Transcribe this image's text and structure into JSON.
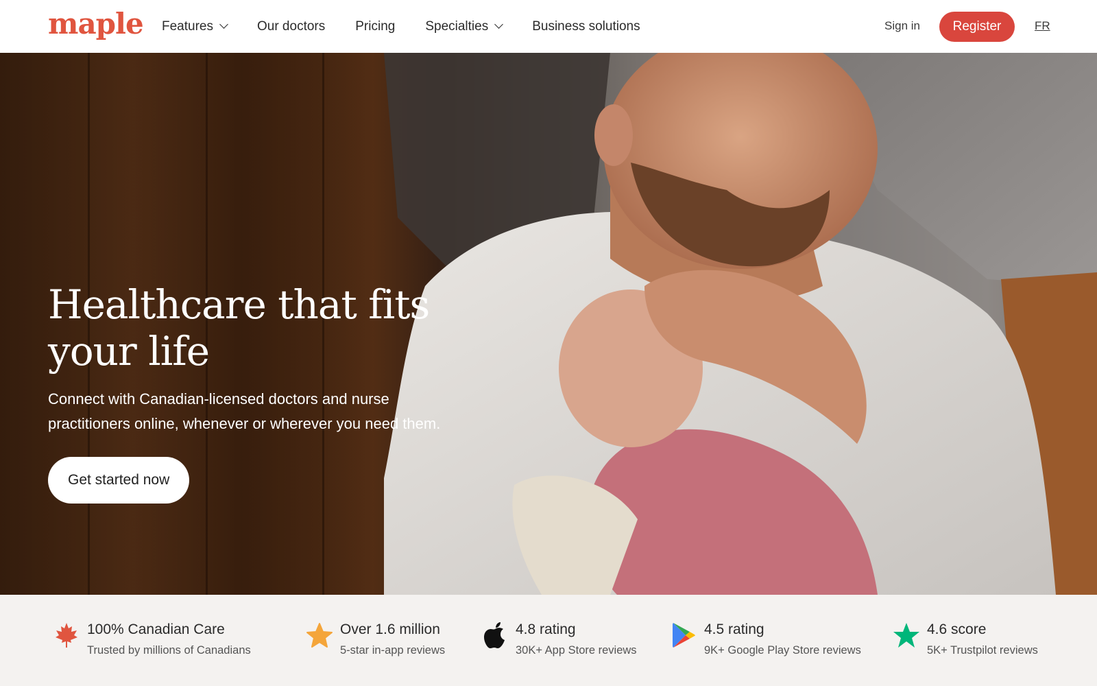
{
  "brand": {
    "logo_text": "maple",
    "accent_color": "#d9463d"
  },
  "nav": {
    "items": [
      {
        "label": "Features",
        "has_dropdown": true
      },
      {
        "label": "Our doctors",
        "has_dropdown": false
      },
      {
        "label": "Pricing",
        "has_dropdown": false
      },
      {
        "label": "Specialties",
        "has_dropdown": true
      },
      {
        "label": "Business solutions",
        "has_dropdown": false
      }
    ],
    "sign_in": "Sign in",
    "register": "Register",
    "language": "FR"
  },
  "hero": {
    "title_line1": "Healthcare that fits",
    "title_line2": "your life",
    "subtitle": "Connect with Canadian-licensed doctors and nurse practitioners online, whenever or wherever you need them.",
    "cta": "Get started now"
  },
  "stats": [
    {
      "icon": "maple-leaf-icon",
      "title": "100% Canadian Care",
      "subtitle": "Trusted by millions of Canadians",
      "color": "#e0553f"
    },
    {
      "icon": "star-icon",
      "title": "Over 1.6 million",
      "subtitle": "5-star in-app reviews",
      "color": "#f4a53a"
    },
    {
      "icon": "apple-icon",
      "title": "4.8 rating",
      "subtitle": "30K+ App Store reviews",
      "color": "#111111"
    },
    {
      "icon": "google-play-icon",
      "title": "4.5 rating",
      "subtitle": "9K+ Google Play Store reviews",
      "color": "#34a853"
    },
    {
      "icon": "trustpilot-star-icon",
      "title": "4.6 score",
      "subtitle": "5K+ Trustpilot reviews",
      "color": "#00b67a"
    }
  ]
}
